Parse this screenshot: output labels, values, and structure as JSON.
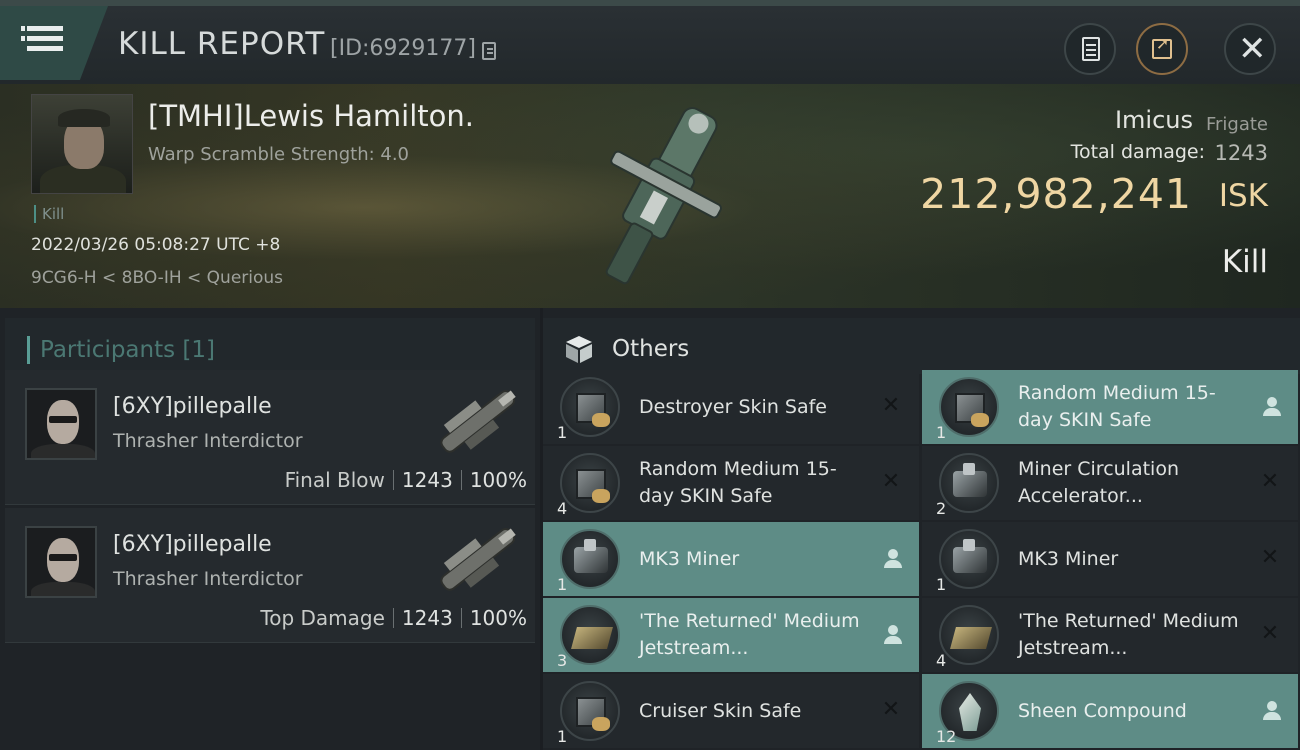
{
  "header": {
    "title": "KILL REPORT",
    "report_id": "[ID:6929177]"
  },
  "victim": {
    "name": "[TMHI]Lewis Hamilton.",
    "warp_scramble": "Warp Scramble Strength: 4.0",
    "tag": "Kill",
    "datetime": "2022/03/26 05:08:27 UTC +8",
    "location": "9CG6-H < 8BO-IH < Querious",
    "ship_name": "Imicus",
    "ship_class": "Frigate",
    "total_damage_label": "Total damage:",
    "total_damage": "1243",
    "isk_value": "212,982,241",
    "isk_unit": "ISK",
    "result": "Kill"
  },
  "participants": {
    "heading": "Participants [1]",
    "items": [
      {
        "name": "[6XY]pillepalle",
        "ship": "Thrasher Interdictor",
        "role": "Final Blow",
        "damage": "1243",
        "percent": "100%"
      },
      {
        "name": "[6XY]pillepalle",
        "ship": "Thrasher Interdictor",
        "role": "Top Damage",
        "damage": "1243",
        "percent": "100%"
      }
    ]
  },
  "others": {
    "heading": "Others",
    "items": [
      {
        "name": "Destroyer Skin Safe",
        "qty": "1",
        "dropped": false,
        "icon": "skin-safe-icon"
      },
      {
        "name": "Random Medium 15-day SKIN Safe",
        "qty": "1",
        "dropped": true,
        "icon": "skin-safe-icon"
      },
      {
        "name": "Random Medium 15-day SKIN Safe",
        "qty": "4",
        "dropped": false,
        "icon": "skin-safe-icon"
      },
      {
        "name": "Miner Circulation Accelerator...",
        "qty": "2",
        "dropped": false,
        "icon": "module-icon"
      },
      {
        "name": "MK3 Miner",
        "qty": "1",
        "dropped": true,
        "icon": "miner-icon"
      },
      {
        "name": "MK3 Miner",
        "qty": "1",
        "dropped": false,
        "icon": "miner-icon"
      },
      {
        "name": "'The Returned' Medium Jetstream...",
        "qty": "3",
        "dropped": true,
        "icon": "jetstream-icon"
      },
      {
        "name": "'The Returned' Medium Jetstream...",
        "qty": "4",
        "dropped": false,
        "icon": "jetstream-icon"
      },
      {
        "name": "Cruiser Skin Safe",
        "qty": "1",
        "dropped": false,
        "icon": "skin-safe-icon"
      },
      {
        "name": "Sheen Compound",
        "qty": "12",
        "dropped": true,
        "icon": "crystal-icon"
      }
    ]
  },
  "colors": {
    "accent_teal": "#5e8c86",
    "isk_gold": "#efd6a3",
    "background": "#1b1e22"
  }
}
